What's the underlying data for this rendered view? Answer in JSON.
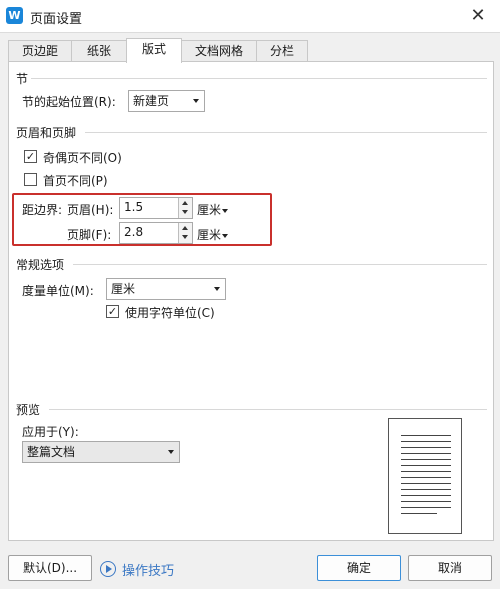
{
  "window": {
    "title": "页面设置",
    "app_icon_glyph": "W",
    "close_glyph": "✕"
  },
  "tabs": [
    {
      "label": "页边距",
      "active": false
    },
    {
      "label": "纸张",
      "active": false
    },
    {
      "label": "版式",
      "active": true
    },
    {
      "label": "文档网格",
      "active": false
    },
    {
      "label": "分栏",
      "active": false
    }
  ],
  "section": {
    "title": "节",
    "start_label": "节的起始位置(R):",
    "start_value": "新建页"
  },
  "header_footer": {
    "title": "页眉和页脚",
    "odd_even_label": "奇偶页不同(O)",
    "odd_even_checked": true,
    "first_page_label": "首页不同(P)",
    "first_page_checked": false,
    "distance_label": "距边界:",
    "header_label": "页眉(H):",
    "header_value": "1.5",
    "footer_label": "页脚(F):",
    "footer_value": "2.8",
    "unit": "厘米"
  },
  "general": {
    "title": "常规选项",
    "measure_label": "度量单位(M):",
    "measure_value": "厘米",
    "char_unit_label": "使用字符单位(C)",
    "char_unit_checked": true
  },
  "preview": {
    "title": "预览",
    "apply_label": "应用于(Y):",
    "apply_value": "整篇文档"
  },
  "footer": {
    "default_button": "默认(D)...",
    "tips_label": "操作技巧",
    "ok_button": "确定",
    "cancel_button": "取消"
  },
  "colors": {
    "highlight_border": "#c9302c",
    "link": "#3b78c4",
    "app_icon": "#1a86d9"
  }
}
